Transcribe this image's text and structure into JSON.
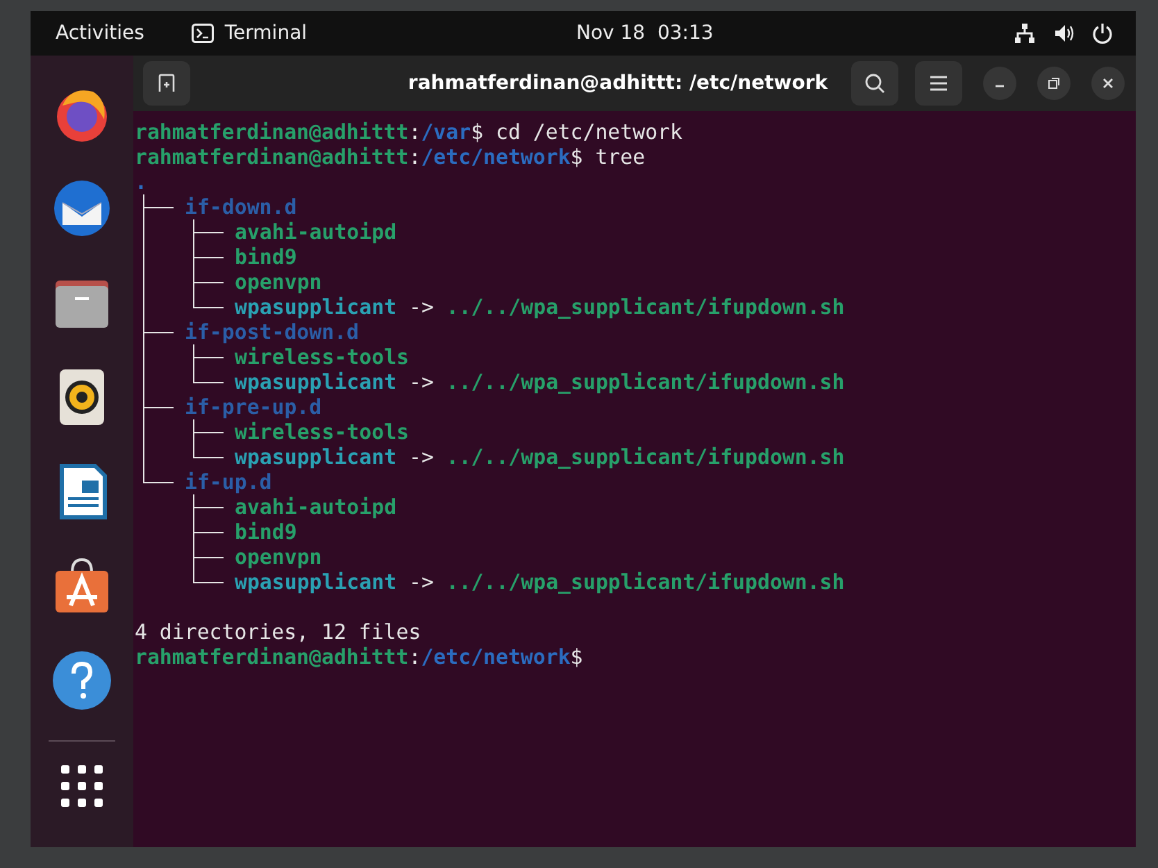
{
  "top_bar": {
    "activities": "Activities",
    "app_name": "Terminal",
    "clock": "Nov 18  03:13"
  },
  "dock": {
    "apps": [
      {
        "kind": "browser"
      },
      {
        "kind": "mail"
      },
      {
        "kind": "files"
      },
      {
        "kind": "music"
      },
      {
        "kind": "writer"
      },
      {
        "kind": "store"
      },
      {
        "kind": "help"
      }
    ]
  },
  "window": {
    "title": "rahmatferdinan@adhittt: /etc/network"
  },
  "terminal": {
    "commands": [
      {
        "user": "rahmatferdinan@adhittt",
        "separator": ":",
        "path": "/var",
        "symbol": "$",
        "command": "cd /etc/network"
      },
      {
        "user": "rahmatferdinan@adhittt",
        "separator": ":",
        "path": "/etc/network",
        "symbol": "$",
        "command": "tree"
      }
    ],
    "tree": {
      "root": ".",
      "children": [
        {
          "name": "if-down.d",
          "kind": "dir",
          "children": [
            {
              "name": "avahi-autoipd",
              "kind": "file"
            },
            {
              "name": "bind9",
              "kind": "file"
            },
            {
              "name": "openvpn",
              "kind": "file"
            },
            {
              "name": "wpasupplicant",
              "kind": "link",
              "arrow": "->",
              "target": "../../wpa_supplicant/ifupdown.sh"
            }
          ]
        },
        {
          "name": "if-post-down.d",
          "kind": "dir",
          "children": [
            {
              "name": "wireless-tools",
              "kind": "file"
            },
            {
              "name": "wpasupplicant",
              "kind": "link",
              "arrow": "->",
              "target": "../../wpa_supplicant/ifupdown.sh"
            }
          ]
        },
        {
          "name": "if-pre-up.d",
          "kind": "dir",
          "children": [
            {
              "name": "wireless-tools",
              "kind": "file"
            },
            {
              "name": "wpasupplicant",
              "kind": "link",
              "arrow": "->",
              "target": "../../wpa_supplicant/ifupdown.sh"
            }
          ]
        },
        {
          "name": "if-up.d",
          "kind": "dir",
          "children": [
            {
              "name": "avahi-autoipd",
              "kind": "file"
            },
            {
              "name": "bind9",
              "kind": "file"
            },
            {
              "name": "openvpn",
              "kind": "file"
            },
            {
              "name": "wpasupplicant",
              "kind": "link",
              "arrow": "->",
              "target": "../../wpa_supplicant/ifupdown.sh"
            }
          ]
        }
      ]
    },
    "summary": "4 directories, 12 files",
    "prompt": {
      "user": "rahmatferdinan@adhittt",
      "separator": ":",
      "path": "/etc/network",
      "symbol": "$"
    }
  }
}
